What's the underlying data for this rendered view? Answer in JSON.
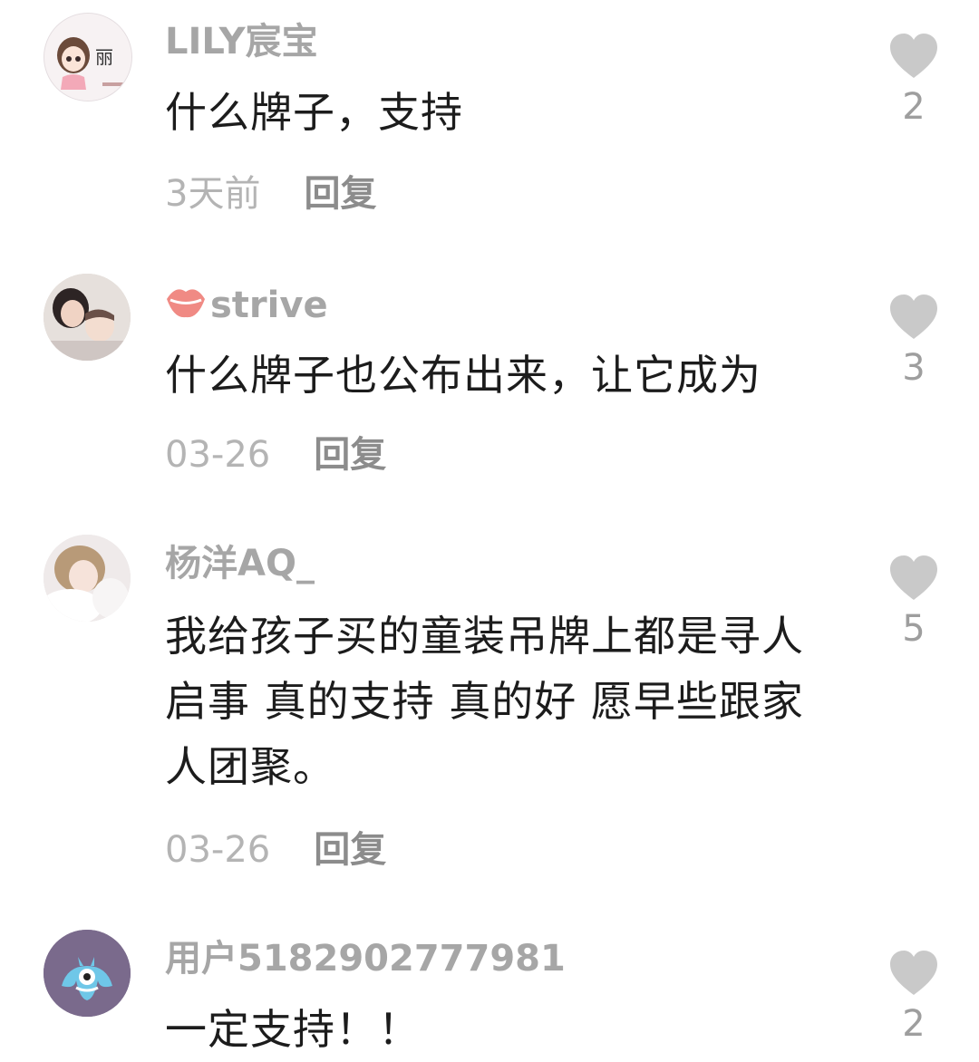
{
  "comments": [
    {
      "username": "LILY宸宝",
      "text": "什么牌子，支持",
      "time": "3天前",
      "reply_label": "回复",
      "likes": "2",
      "avatar_icon": "cartoon-girl-avatar",
      "avatar_text": "丽"
    },
    {
      "username": "strive",
      "username_emoji": "kiss-lips-icon",
      "text": "什么牌子也公布出来，让它成为",
      "time": "03-26",
      "reply_label": "回复",
      "likes": "3",
      "avatar_icon": "photo-avatar"
    },
    {
      "username": "杨洋AQ_",
      "text": "我给孩子买的童装吊牌上都是寻人启事 真的支持 真的好 愿早些跟家人团聚。",
      "time": "03-26",
      "reply_label": "回复",
      "likes": "5",
      "avatar_icon": "photo-avatar"
    },
    {
      "username": "用户5182902777981",
      "text": "一定支持！！",
      "likes": "2",
      "avatar_icon": "blue-monster-avatar"
    }
  ],
  "colors": {
    "username": "#a6a6a6",
    "text": "#1c1c1c",
    "like_icon": "#c9c9c9"
  }
}
